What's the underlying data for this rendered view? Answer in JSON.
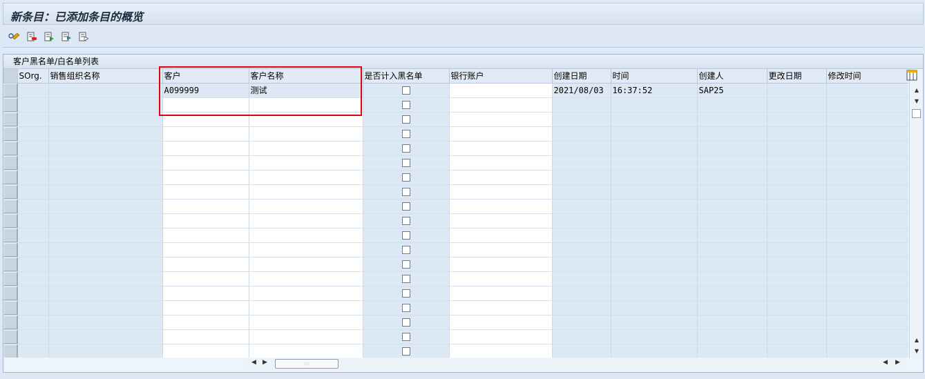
{
  "title": "新条目：已添加条目的概览",
  "toolbar": {
    "icons": [
      "other-view-icon",
      "delete-rows-icon",
      "select-all-icon",
      "select-block-icon",
      "deselect-all-icon"
    ]
  },
  "table_title": "客户黑名单/白名单列表",
  "columns": {
    "sorg": "SOrg.",
    "sorg_name": "销售组织名称",
    "customer": "客户",
    "customer_name": "客户名称",
    "blacklisted": "是否计入黑名单",
    "bank_account": "银行账户",
    "created_date": "创建日期",
    "time": "时间",
    "created_by": "创建人",
    "changed_date": "更改日期",
    "changed_time": "修改时间"
  },
  "rows": [
    {
      "sorg": "",
      "sorg_name": "",
      "customer": "A099999",
      "customer_name": "测试",
      "blacklisted": false,
      "bank_account": "",
      "created_date": "2021/08/03",
      "time": "16:37:52",
      "created_by": "SAP25",
      "changed_date": "",
      "changed_time": ""
    }
  ],
  "empty_row_count": 19,
  "colors": {
    "highlight": "#e60012",
    "grid_bg": "#dce8f3",
    "input_bg": "#ffffff"
  }
}
